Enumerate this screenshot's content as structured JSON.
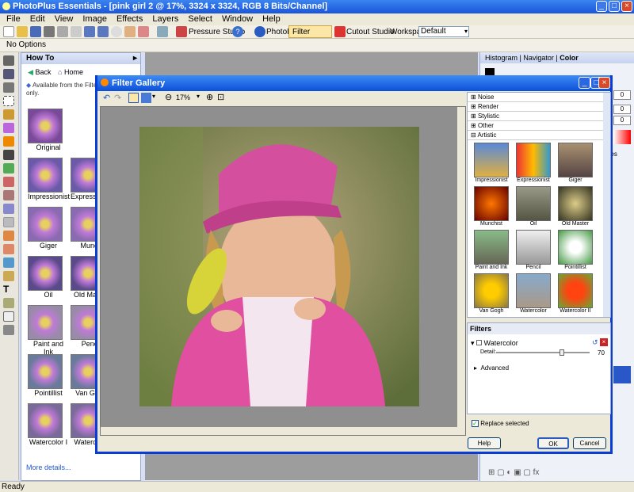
{
  "app": {
    "title": "PhotoPlus Essentials - [pink girl 2 @ 17%, 3324 x 3324, RGB 8 Bits/Channel]",
    "status": "Ready"
  },
  "menu": [
    "File",
    "Edit",
    "View",
    "Image",
    "Effects",
    "Layers",
    "Select",
    "Window",
    "Help"
  ],
  "toolbar": {
    "pressure_studio": "Pressure Studio",
    "photofix": "PhotoFix",
    "filter_gallery": "Filter Gallery",
    "cutout_studio": "Cutout Studio",
    "workspace_label": "Workspace",
    "workspace_value": "Default"
  },
  "options": {
    "label": "No Options"
  },
  "howto": {
    "title": "How To",
    "back": "Back",
    "home": "Home",
    "notice": "Available from the Filter Gallery only.",
    "more": "More details...",
    "thumbs": [
      [
        "Original",
        ""
      ],
      [
        "Impressionist",
        "Expressionist"
      ],
      [
        "Giger",
        "Munch"
      ],
      [
        "Oil",
        "Old Master"
      ],
      [
        "Paint and Ink",
        "Pencil"
      ],
      [
        "Pointillist",
        "Van Gogh"
      ],
      [
        "Watercolor I",
        "Watercolor"
      ]
    ]
  },
  "right": {
    "tabs": [
      "Histogram",
      "Navigator",
      "Color"
    ],
    "values": [
      "0",
      "0",
      "0"
    ],
    "ches": "ches"
  },
  "dialog": {
    "title": "Filter Gallery",
    "zoom": "17%",
    "categories": [
      "Noise",
      "Render",
      "Stylistic",
      "Other",
      "Artistic"
    ],
    "filters": [
      "Impressionist",
      "Expressionist",
      "Giger",
      "Munchist",
      "Oil",
      "Old Master",
      "Paint and Ink",
      "Pencil",
      "Pointillist",
      "Van Gogh",
      "Watercolor",
      "Watercolor II"
    ],
    "filters_title": "Filters",
    "applied": "Watercolor",
    "detail_label": "Detail:",
    "detail_value": "70",
    "advanced": "Advanced",
    "replace": "Replace selected",
    "help": "Help",
    "ok": "OK",
    "cancel": "Cancel"
  }
}
